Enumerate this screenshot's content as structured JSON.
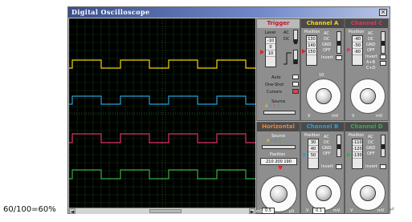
{
  "window": {
    "title": "Digital Oscilloscope",
    "close": "×"
  },
  "caption": "60/100=60%",
  "para_mark": "↵",
  "scroll": {
    "left": "◄",
    "right": "►"
  },
  "trigger": {
    "title": "Trigger",
    "level_label": "Level",
    "level_values": [
      "-10",
      "0",
      "10"
    ],
    "modes": [
      "AC",
      "DC"
    ],
    "buttons": [
      "Auto",
      "One-Shot",
      "Cursors"
    ],
    "source_label": "Source",
    "source_channels": [
      "A",
      "B",
      "C",
      "D"
    ]
  },
  "channel_a": {
    "title": "Channel A",
    "color": "#f5d60a",
    "position_label": "Position",
    "position_values": [
      "130",
      "140",
      "150"
    ],
    "modes": [
      "AC",
      "DC",
      "GND",
      "OFF",
      "Invert"
    ],
    "scale": [
      "2",
      "5",
      "10",
      "20"
    ],
    "unit": "V",
    "unit2": "mV"
  },
  "channel_b": {
    "title": "Channel B",
    "color": "#2a9fd8",
    "position_label": "Position",
    "position_values": [
      "30",
      "40",
      "50"
    ],
    "modes": [
      "AC",
      "DC",
      "GND",
      "OFF",
      "Invert"
    ],
    "readout": "0.1",
    "unit": "V",
    "unit2": "mV"
  },
  "channel_c": {
    "title": "Channel C",
    "color": "#e0336b",
    "position_label": "Position",
    "position_values": [
      "-40",
      "-50",
      "-60"
    ],
    "modes": [
      "AC",
      "DC",
      "GND",
      "OFF",
      "Invert",
      "A+B",
      "C+D"
    ],
    "unit": "V",
    "unit2": "mV"
  },
  "channel_d": {
    "title": "Channel D",
    "color": "#33b043",
    "position_label": "Position",
    "position_values": [
      "-110",
      "-120",
      "-130"
    ],
    "modes": [
      "AC",
      "DC",
      "GND",
      "OFF",
      "Invert"
    ],
    "unit": "V",
    "unit2": "mV"
  },
  "horizontal": {
    "title": "Horizontal",
    "source_label": "Source",
    "source_channels": [
      "A",
      "B",
      "C",
      "D"
    ],
    "position_label": "Position",
    "position_values": [
      "210",
      "200",
      "190"
    ],
    "readout": "0.5",
    "unit": "mS",
    "unit2": "µS"
  },
  "traces": {
    "A": {
      "color": "#f5d60a",
      "high": 52,
      "low": 62
    },
    "B": {
      "color": "#2a9fd8",
      "high": 97,
      "low": 107
    },
    "C": {
      "color": "#e0336b",
      "high": 144,
      "low": 155
    },
    "D": {
      "color": "#33b043",
      "high": 189,
      "low": 200
    }
  }
}
